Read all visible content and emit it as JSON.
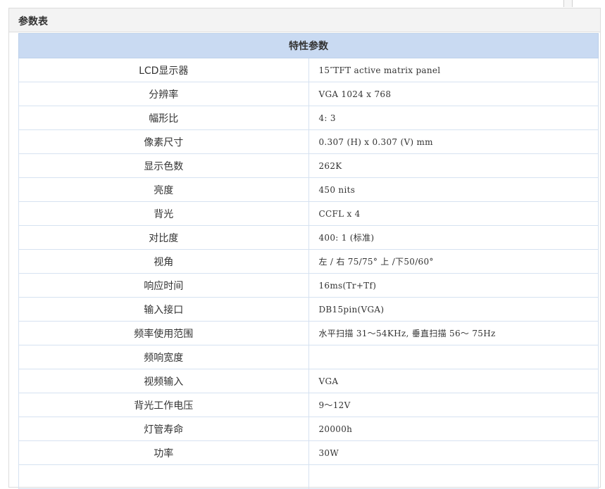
{
  "panel": {
    "title": "参数表"
  },
  "table": {
    "header": "特性参数",
    "rows": [
      {
        "key": "LCD显示器",
        "value": "15″TFT active matrix panel"
      },
      {
        "key": "分辨率",
        "value": "VGA 1024 x 768"
      },
      {
        "key": "幅形比",
        "value": "4: 3"
      },
      {
        "key": "像素尺寸",
        "value": "0.307 (H) x 0.307 (V) mm"
      },
      {
        "key": "显示色数",
        "value": "262K"
      },
      {
        "key": "亮度",
        "value": "450 nits"
      },
      {
        "key": "背光",
        "value": "CCFL x 4"
      },
      {
        "key": "对比度",
        "value": "400: 1 (标准)"
      },
      {
        "key": "视角",
        "value": "左 / 右 75/75° 上 /下50/60°"
      },
      {
        "key": "响应时间",
        "value": "16ms(Tr+Tf)"
      },
      {
        "key": "输入接口",
        "value": "DB15pin(VGA)"
      },
      {
        "key": "频率使用范围",
        "value": "水平扫描 31～54KHz, 垂直扫描 56～ 75Hz"
      },
      {
        "key": "频响宽度",
        "value": ""
      },
      {
        "key": "视频输入",
        "value": "VGA"
      },
      {
        "key": "背光工作电压",
        "value": "9～12V"
      },
      {
        "key": "灯管寿命",
        "value": "20000h"
      },
      {
        "key": "功率",
        "value": "30W"
      },
      {
        "key": "",
        "value": ""
      }
    ]
  },
  "colors": {
    "header_bg": "#c9daf2",
    "panel_header_bg": "#f3f3f3",
    "border": "#d6e2f1"
  }
}
